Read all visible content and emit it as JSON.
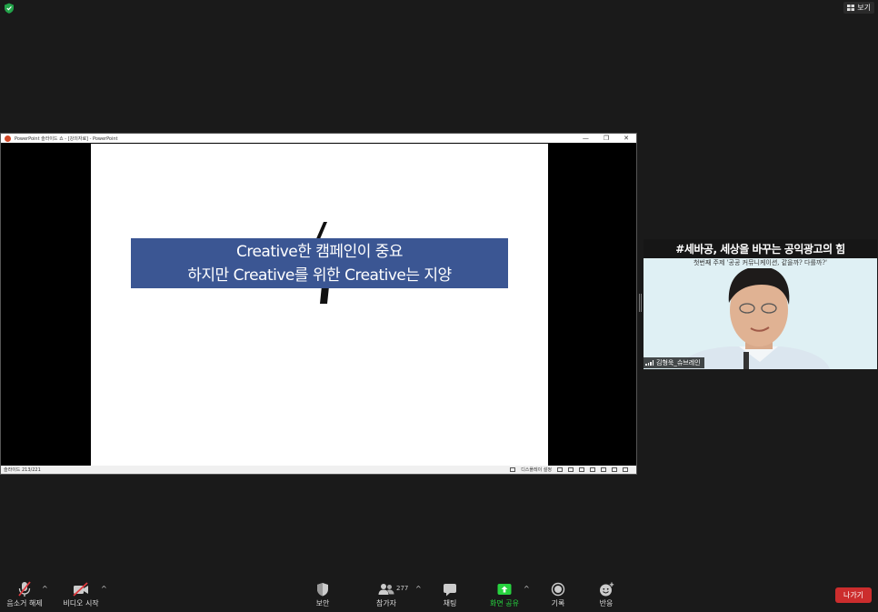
{
  "top": {
    "view_label": "보기"
  },
  "ppt": {
    "title": "PowerPoint 슬라이드 쇼 - [강의자료] - PowerPoint",
    "window_controls": [
      "—",
      "❐",
      "✕"
    ],
    "slide_line1": "Creative한 캠페인이 중요",
    "slide_line2": "하지만 Creative를 위한 Creative는 지양",
    "status_left": "슬라이드 213/221",
    "status_display": "디스플레이 설정"
  },
  "video": {
    "banner": "#세바공, 세상을 바꾸는 공익광고의 힘",
    "subtitle": "첫번째 주제 '공공 커뮤니케이션, 같을까? 다를까?'",
    "name": "김형욱_슈브레인"
  },
  "toolbar": {
    "mute_label": "음소거 해제",
    "video_label": "비디오 시작",
    "security_label": "보안",
    "participants_label": "참가자",
    "participants_count": "277",
    "chat_label": "채팅",
    "share_label": "화면 공유",
    "record_label": "기록",
    "reactions_label": "반응",
    "leave_label": "나가기",
    "caret": "^"
  },
  "colors": {
    "background": "#1a1a1a",
    "slide_box": "#3b5693",
    "share_green": "#27d33f",
    "leave_red": "#cc2d2d"
  }
}
